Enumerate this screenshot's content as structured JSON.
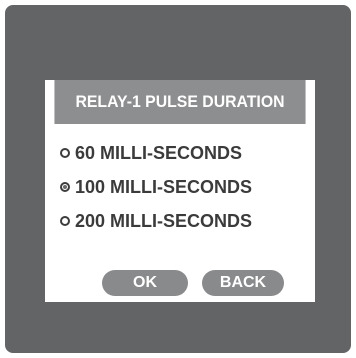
{
  "dialog": {
    "title": "RELAY-1 PULSE DURATION",
    "options": [
      {
        "label": "60 MILLI-SECONDS",
        "selected": false
      },
      {
        "label": "100 MILLI-SECONDS",
        "selected": true
      },
      {
        "label": "200 MILLI-SECONDS",
        "selected": false
      }
    ],
    "ok_label": "OK",
    "back_label": "BACK"
  },
  "colors": {
    "device_background": "#626466",
    "title_bar": "#8d8e90",
    "button": "#898a8c",
    "text": "#3b3b3b"
  }
}
